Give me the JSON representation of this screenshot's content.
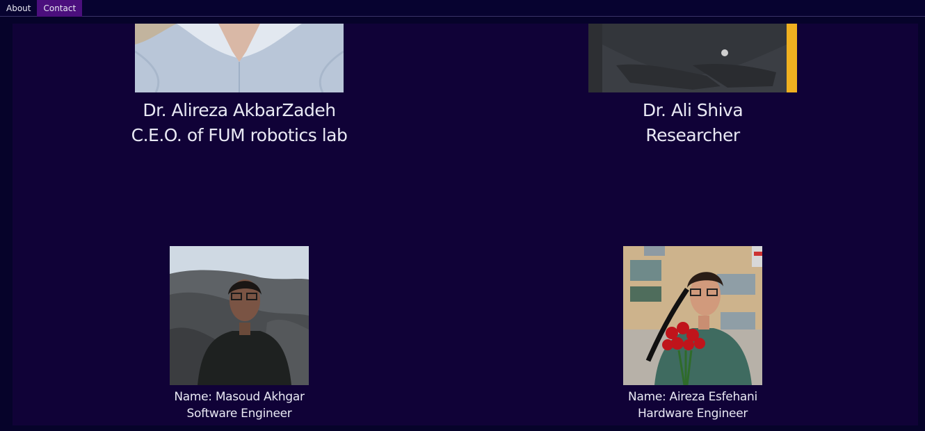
{
  "nav": {
    "items": [
      {
        "label": "About"
      },
      {
        "label": "Contact"
      }
    ]
  },
  "people": [
    {
      "name": "Dr. Alireza AkbarZadeh",
      "role": "C.E.O. of FUM robotics lab"
    },
    {
      "name": "Dr. Ali Shiva",
      "role": "Researcher"
    },
    {
      "name": "Name: Masoud Akhgar",
      "role": "Software Engineer"
    },
    {
      "name": "Name: Aireza Esfehani",
      "role": "Hardware Engineer"
    }
  ],
  "colors": {
    "page_bg": "#06032a",
    "panel_bg": "#100237",
    "nav_active": "#4b0f7d"
  }
}
